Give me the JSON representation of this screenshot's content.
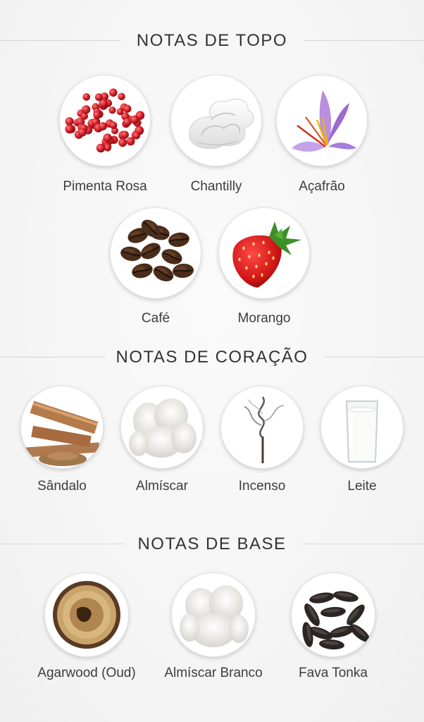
{
  "sections": {
    "top": {
      "title": "NOTAS DE TOPO",
      "notes": [
        "Pimenta Rosa",
        "Chantilly",
        "Açafrão",
        "Café",
        "Morango"
      ]
    },
    "heart": {
      "title": "NOTAS DE CORAÇÃO",
      "notes": [
        "Sândalo",
        "Almíscar",
        "Incenso",
        "Leite"
      ]
    },
    "base": {
      "title": "NOTAS DE BASE",
      "notes": [
        "Agarwood (Oud)",
        "Almíscar Branco",
        "Fava Tonka"
      ]
    }
  },
  "icons": {
    "top": [
      "pink-peppercorn-icon",
      "whipped-cream-icon",
      "saffron-flower-icon",
      "coffee-beans-icon",
      "strawberry-icon"
    ],
    "heart": [
      "sandalwood-icon",
      "musk-icon",
      "incense-smoke-icon",
      "milk-glass-icon"
    ],
    "base": [
      "agarwood-icon",
      "white-musk-icon",
      "tonka-beans-icon"
    ]
  }
}
